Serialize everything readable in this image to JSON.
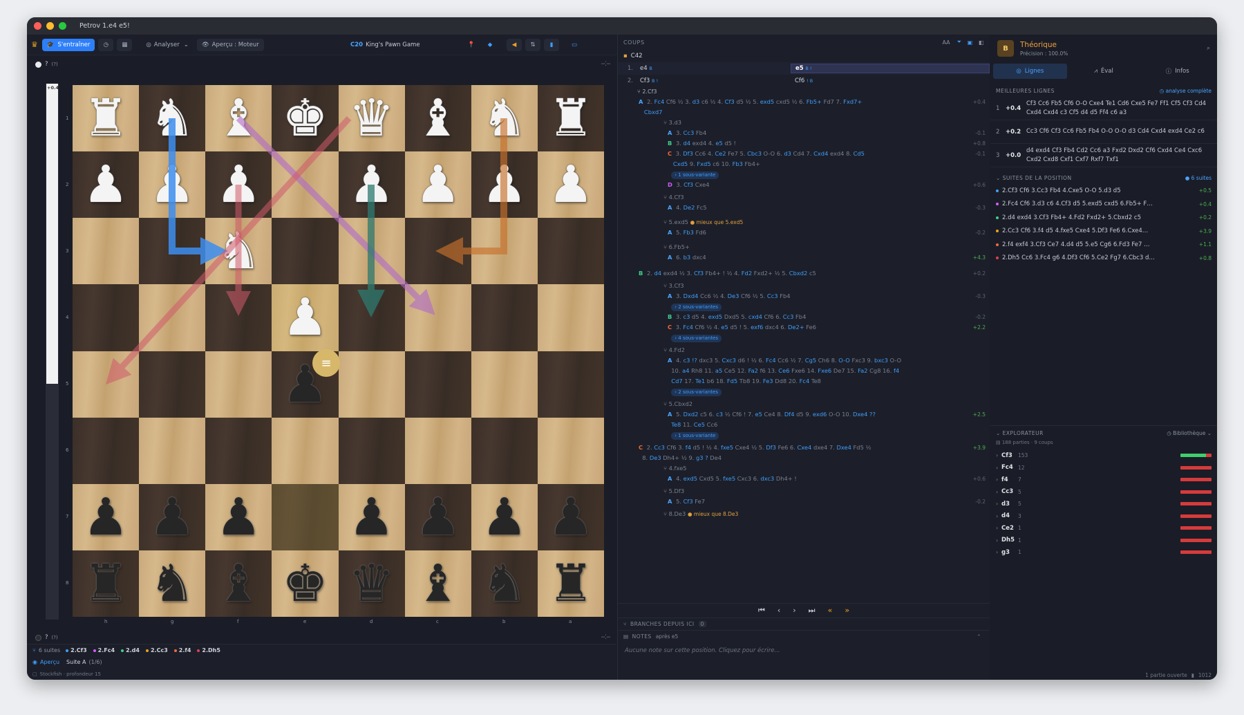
{
  "window": {
    "title": "Petrov 1.e4 e5!"
  },
  "toolbar": {
    "train": "S'entraîner",
    "analyze": "Analyser",
    "preview": "Aperçu : Moteur",
    "eco": "C20",
    "opening": "King's Pawn Game"
  },
  "top_eval": {
    "label": "?",
    "detail": "(?)"
  },
  "bottom_eval": {
    "label": "?",
    "detail": "(?)"
  },
  "eval_bar": {
    "value": "+0.4",
    "white_fraction": 0.56
  },
  "ranks": [
    "1",
    "2",
    "3",
    "4",
    "5",
    "6",
    "7",
    "8"
  ],
  "files": [
    "h",
    "g",
    "f",
    "e",
    "d",
    "c",
    "b",
    "a"
  ],
  "board": [
    [
      "wR",
      "wN",
      "wB",
      "wK",
      "wQ",
      "wB",
      "wN",
      "wR"
    ],
    [
      "wP",
      "wP",
      "wP",
      "",
      "wP",
      "wP",
      "wP",
      "wP"
    ],
    [
      "",
      "",
      "wN",
      "",
      "",
      "",
      "",
      ""
    ],
    [
      "",
      "",
      "",
      "wP",
      "",
      "",
      "",
      ""
    ],
    [
      "",
      "",
      "",
      "bP",
      "",
      "",
      "",
      ""
    ],
    [
      "",
      "",
      "",
      "",
      "",
      "",
      "",
      ""
    ],
    [
      "bP",
      "bP",
      "bP",
      "",
      "bP",
      "bP",
      "bP",
      "bP"
    ],
    [
      "bR",
      "bN",
      "bB",
      "bK",
      "bQ",
      "bB",
      "bN",
      "bR"
    ]
  ],
  "left_status": {
    "count": "6 suites",
    "moves": [
      {
        "m": "2.Cf3",
        "c": "#3fa0ff"
      },
      {
        "m": "2.Fc4",
        "c": "#d45cff"
      },
      {
        "m": "2.d4",
        "c": "#3fcf8e"
      },
      {
        "m": "2.Cc3",
        "c": "#f0a020"
      },
      {
        "m": "2.f4",
        "c": "#f06a3c"
      },
      {
        "m": "2.Dh5",
        "c": "#e04050"
      }
    ],
    "preview": "Aperçu",
    "suite": "Suite A",
    "suite_idx": "(1/6)",
    "engine": "Stockfish · profondeur 15"
  },
  "moves": {
    "header": "COUPS",
    "eco": "C42",
    "rows": [
      {
        "n": "1.",
        "w": "e4",
        "wsup": "B",
        "b": "e5",
        "bsup": "B !"
      },
      {
        "n": "2.",
        "w": "Cf3",
        "wsup": "B !",
        "b": "Cf6",
        "bsup": "! B"
      }
    ],
    "sub_root": "2.Cf3",
    "nav": [
      "⏮",
      "‹",
      "›",
      "⏭",
      "«",
      "»"
    ],
    "branches": "BRANCHES DEPUIS ICI",
    "branches_count": "0",
    "notes": "NOTES",
    "notes_after": "après e5",
    "notes_placeholder": "Aucune note sur cette position. Cliquez pour écrire..."
  },
  "right": {
    "title": "Théorique",
    "subtitle": "Précision : 100.0%",
    "badge": "B",
    "tabs": [
      "Lignes",
      "Éval",
      "Infos"
    ],
    "best_header": "MEILLEURES LIGNES",
    "best_action": "analyse complète",
    "lines": [
      {
        "n": "1",
        "e": "+0.4",
        "t": "Cf3 Cc6 Fb5 Cf6 O-O Cxe4 Te1 Cd6 Cxe5 Fe7 Ff1 Cf5 Cf3 Cd4 Cxd4 Cxd4 c3 Cf5 d4 d5 Ff4 c6 a3"
      },
      {
        "n": "2",
        "e": "+0.2",
        "t": "Cc3 Cf6 Cf3 Cc6 Fb5 Fb4 O-O O-O d3 Cd4 Cxd4 exd4 Ce2 c6"
      },
      {
        "n": "3",
        "e": "+0.0",
        "t": "d4 exd4 Cf3 Fb4 Cd2 Cc6 a3 Fxd2 Dxd2 Cf6 Cxd4 Ce4 Cxc6 Cxd2 Cxd8 Cxf1 Cxf7 Rxf7 Txf1"
      }
    ],
    "cont_header": "SUITES DE LA POSITION",
    "cont_count": "6 suites",
    "cont": [
      {
        "c": "#3fa0ff",
        "t": "2.Cf3 Cf6 3.Cc3 Fb4 4.Cxe5 O-O 5.d3 d5",
        "v": "+0.5"
      },
      {
        "c": "#d45cff",
        "t": "2.Fc4 Cf6 3.d3 c6 4.Cf3 d5 5.exd5 cxd5 6.Fb5+ F…",
        "v": "+0.4"
      },
      {
        "c": "#3fcf8e",
        "t": "2.d4 exd4 3.Cf3 Fb4+ 4.Fd2 Fxd2+ 5.Cbxd2 c5",
        "v": "+0.2"
      },
      {
        "c": "#f0a020",
        "t": "2.Cc3 Cf6 3.f4 d5 4.fxe5 Cxe4 5.Df3 Fe6 6.Cxe4…",
        "v": "+3.9"
      },
      {
        "c": "#f06a3c",
        "t": "2.f4 exf4 3.Cf3 Ce7 4.d4 d5 5.e5 Cg6 6.Fd3 Fe7 …",
        "v": "+1.1"
      },
      {
        "c": "#e04050",
        "t": "2.Dh5 Cc6 3.Fc4 g6 4.Df3 Cf6 5.Ce2 Fg7 6.Cbc3 d…",
        "v": "+0.8"
      }
    ],
    "explorer": "EXPLORATEUR",
    "library": "Bibliothèque",
    "explorer_info": "188 parties · 9 coups",
    "ex": [
      {
        "m": "Cf3",
        "k": "153",
        "w": 0.82
      },
      {
        "m": "Fc4",
        "k": "12",
        "w": 0
      },
      {
        "m": "f4",
        "k": "7",
        "w": 0
      },
      {
        "m": "Cc3",
        "k": "5",
        "w": 0
      },
      {
        "m": "d3",
        "k": "5",
        "w": 0
      },
      {
        "m": "d4",
        "k": "3",
        "w": 0
      },
      {
        "m": "Ce2",
        "k": "1",
        "w": 0
      },
      {
        "m": "Dh5",
        "k": "1",
        "w": 0
      },
      {
        "m": "g3",
        "k": "1",
        "w": 0
      }
    ],
    "status": "1 partie ouverte",
    "status_count": "1012"
  }
}
